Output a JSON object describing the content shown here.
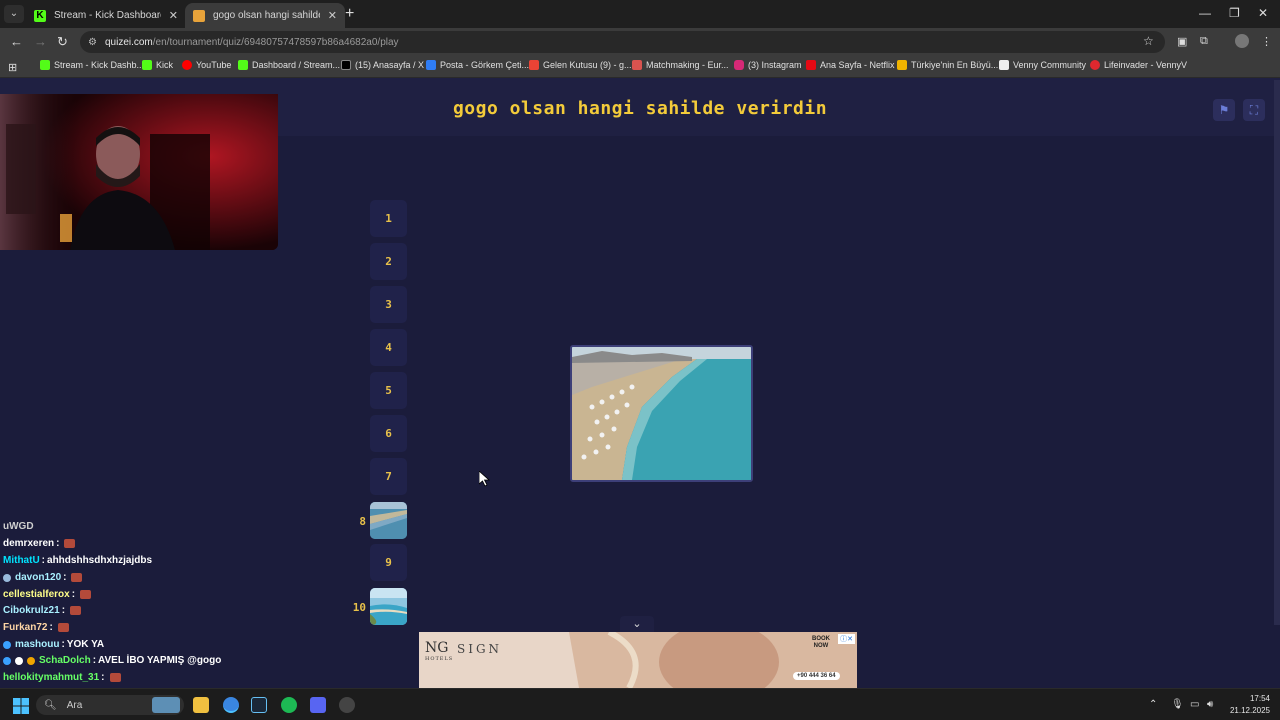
{
  "browser": {
    "tabs": [
      {
        "title": "Stream - Kick Dashboard",
        "favicon": "kick-icon"
      },
      {
        "title": "gogo olsan hangi sahilde verirdin",
        "favicon": "quizzes-icon"
      }
    ],
    "url_host": "quizei.com",
    "url_path": "/en/tournament/quiz/69480757478597b86a4682a0/play",
    "bookmarks": [
      "Stream - Kick Dashb...",
      "Kick",
      "YouTube",
      "Dashboard / Stream...",
      "(15) Anasayfa / X",
      "Posta - Görkem Çeti...",
      "Gelen Kutusu (9) - g...",
      "Matchmaking - Eur...",
      "(3) Instagram",
      "Ana Sayfa - Netflix",
      "Türkiye'nin En Büyü...",
      "Venny Community",
      "Lifeinvader - VennyV"
    ]
  },
  "quiz": {
    "title": "gogo olsan hangi sahilde verirdin",
    "slots": [
      "1",
      "2",
      "3",
      "4",
      "5",
      "6",
      "7",
      "8",
      "9",
      "10"
    ],
    "filled_slot_labels": [
      "8",
      "10"
    ]
  },
  "chat": [
    {
      "user": "demrxeren",
      "msg": "",
      "emote": true,
      "color": "#ffffff"
    },
    {
      "user": "MithatU",
      "msg": "ahhdshhsdhxhzjajdbs",
      "emote": false,
      "color": "#00e5ff"
    },
    {
      "user": "davon120",
      "msg": "",
      "emote": true,
      "color": "#a9f0ff"
    },
    {
      "user": "cellestialferox",
      "msg": "",
      "emote": true,
      "color": "#ffff8a"
    },
    {
      "user": "Cibokrulz21",
      "msg": "",
      "emote": true,
      "color": "#a9f0ff"
    },
    {
      "user": "Furkan72",
      "msg": "",
      "emote": true,
      "color": "#ffd6a5"
    },
    {
      "user": "mashouu",
      "msg": "YOK YA",
      "emote": false,
      "color": "#a9f0ff"
    },
    {
      "user": "SchaDolch",
      "msg": "AVEL İBO YAPMIŞ @gogo",
      "emote": false,
      "color": "#66ff66"
    },
    {
      "user": "hellokitymahmut_31",
      "msg": "",
      "emote": true,
      "color": "#66ff66"
    },
    {
      "user": "hellokitymahmut_31",
      "msg": "",
      "emote": true,
      "color": "#66ff66"
    }
  ],
  "chat_cutoff": "uWGD",
  "ad": {
    "brand": "NG",
    "brand_sub": "HOTELS",
    "name": "SIGN",
    "cta": "BOOK NOW",
    "phone": "+90 444 36 64"
  },
  "taskbar": {
    "search_label": "Ara",
    "time": "17:54",
    "date": "21.12.2025"
  }
}
